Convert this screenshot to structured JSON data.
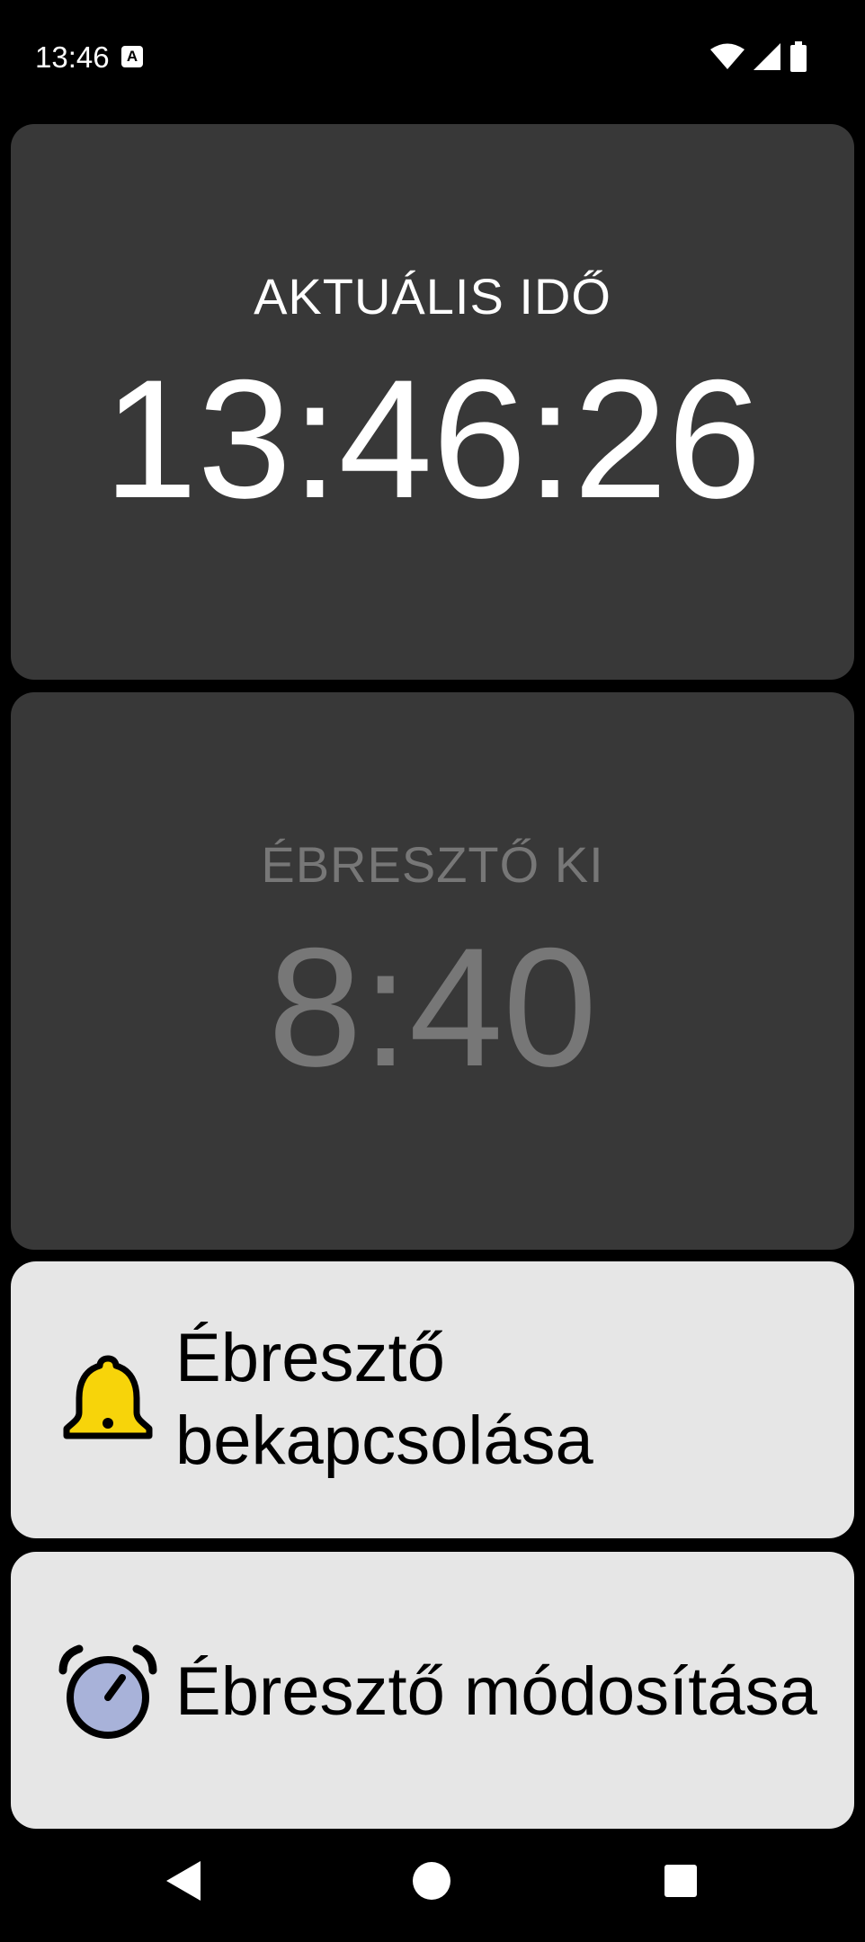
{
  "status_bar": {
    "time": "13:46",
    "notification_icon": "a-icon",
    "icons": [
      "wifi-icon",
      "cellular-signal-icon",
      "battery-icon"
    ]
  },
  "current_time_panel": {
    "label": "AKTUÁLIS IDŐ",
    "value": "13:46:26"
  },
  "alarm_panel": {
    "label": "ÉBRESZTŐ KI",
    "value": "8:40"
  },
  "actions": {
    "toggle_alarm": {
      "label": "Ébresztő\nbekapcsolása",
      "icon": "bell-icon"
    },
    "edit_alarm": {
      "label": "Ébresztő módosítása",
      "icon": "alarm-clock-icon"
    }
  },
  "navigation": {
    "buttons": [
      "back-icon",
      "home-icon",
      "recents-icon"
    ]
  },
  "colors": {
    "background": "#000000",
    "panel": "#383838",
    "button": "#e6e6e6",
    "disabled_text": "#777777",
    "bell_yellow": "#f7d40a",
    "clock_face": "#a8b2d9"
  }
}
